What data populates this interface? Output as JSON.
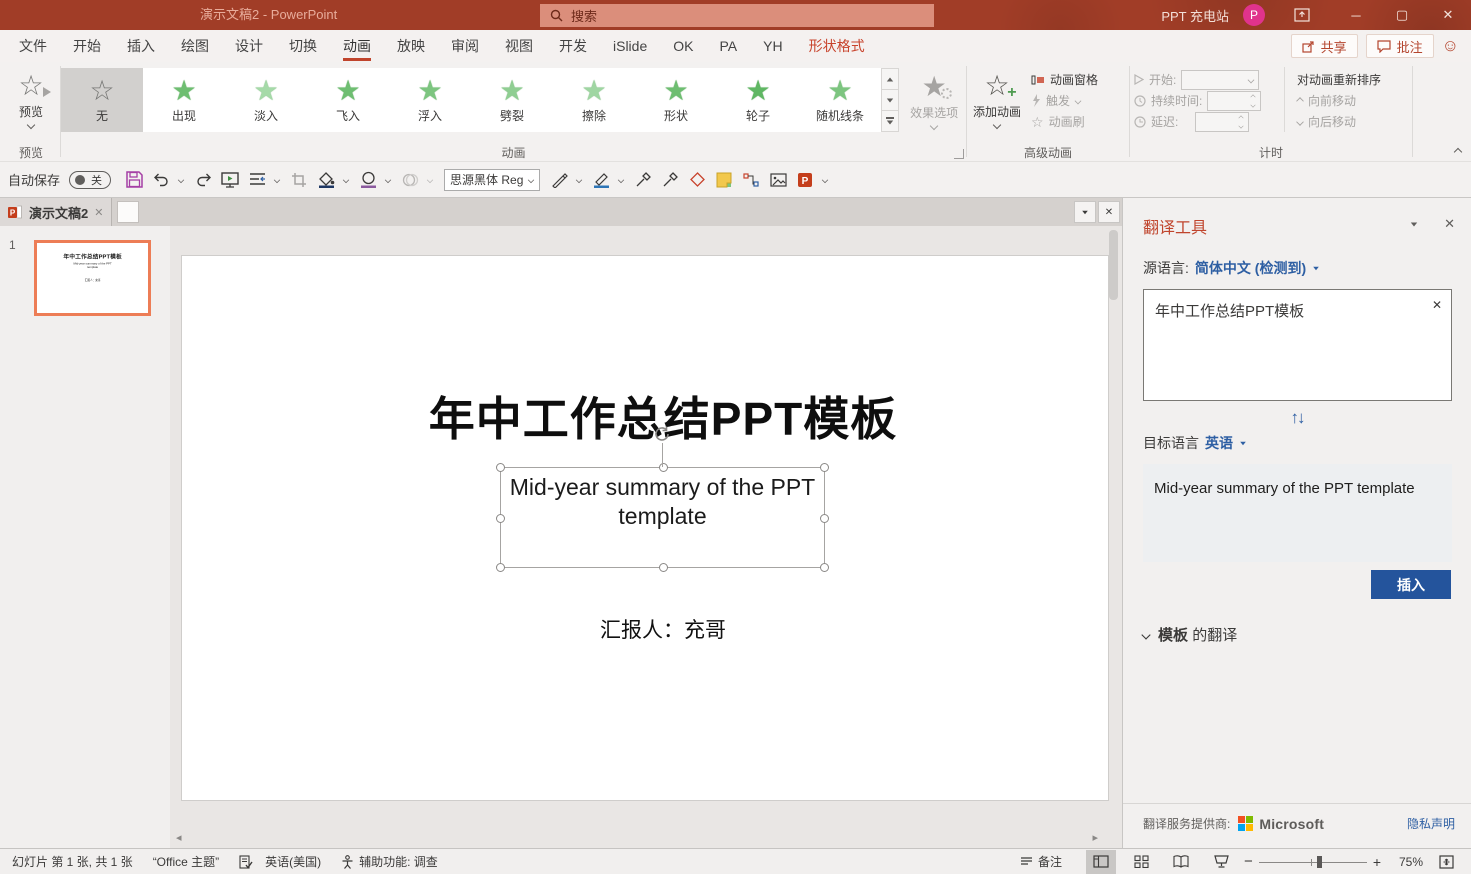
{
  "colors": {
    "titlebar_red": "#A13D27",
    "accent_red": "#C0442C",
    "accent_blue": "#2E5FA3",
    "insert_button_blue": "#24549C",
    "star_green": "#6EBE71",
    "avatar_pink": "#E0338C",
    "ms_logo": [
      "#F25022",
      "#7FBA00",
      "#00A4EF",
      "#FFB900"
    ]
  },
  "icons": {
    "close": "✕",
    "minimize": "─",
    "maximize": "▢",
    "smiley": "☺",
    "star_filled": "★",
    "star_outline": "☆",
    "swap": "↑↓",
    "scroll_left": "◂",
    "scroll_right": "▸"
  },
  "titlebar": {
    "title": "演示文稿2 - PowerPoint",
    "search_placeholder": "搜索",
    "account_name": "PPT 充电站",
    "avatar_initial": "P"
  },
  "ribbon": {
    "tabs": [
      "文件",
      "开始",
      "插入",
      "绘图",
      "设计",
      "切换",
      "动画",
      "放映",
      "审阅",
      "视图",
      "开发",
      "iSlide",
      "OK",
      "PA",
      "YH",
      "形状格式"
    ],
    "active_tab": "动画",
    "share_label": "共享",
    "comments_label": "批注",
    "preview_label": "预览",
    "preview_group": "预览",
    "gallery_items": [
      "无",
      "出现",
      "淡入",
      "飞入",
      "浮入",
      "劈裂",
      "擦除",
      "形状",
      "轮子",
      "随机线条"
    ],
    "selected_animation": "无",
    "animation_group": "动画",
    "effect_options_label": "效果选项",
    "add_animation_label": "添加动画",
    "animation_pane_label": "动画窗格",
    "trigger_label": "触发",
    "animation_painter_label": "动画刷",
    "advanced_group": "高级动画",
    "start_label": "开始:",
    "duration_label": "持续时间:",
    "delay_label": "延迟:",
    "reorder_label": "对动画重新排序",
    "move_earlier_label": "向前移动",
    "move_later_label": "向后移动",
    "timing_group": "计时"
  },
  "qat": {
    "autosave_label": "自动保存",
    "autosave_state": "关",
    "font_name": "思源黑体 Reg"
  },
  "document": {
    "tab_title": "演示文稿2"
  },
  "thumbnails": {
    "slide_number": "1"
  },
  "slide": {
    "title": "年中工作总结PPT模板",
    "subtitle": "Mid-year summary of the PPT template",
    "presenter": "汇报人：充哥"
  },
  "pane": {
    "title": "翻译工具",
    "source_label": "源语言:",
    "source_language": "简体中文 (检测到)",
    "source_text": "年中工作总结PPT模板",
    "target_label": "目标语言",
    "target_language": "英语",
    "translation_text": "Mid-year summary of the PPT template",
    "insert_label": "插入",
    "word": "模板",
    "word_suffix": "的翻译",
    "provider_label": "翻译服务提供商:",
    "provider_name": "Microsoft",
    "privacy_label": "隐私声明"
  },
  "statusbar": {
    "slide_info": "幻灯片 第 1 张, 共 1 张",
    "theme": "“Office 主题”",
    "language": "英语(美国)",
    "accessibility": "辅助功能: 调查",
    "notes_label": "备注",
    "zoom_level": "75%"
  }
}
